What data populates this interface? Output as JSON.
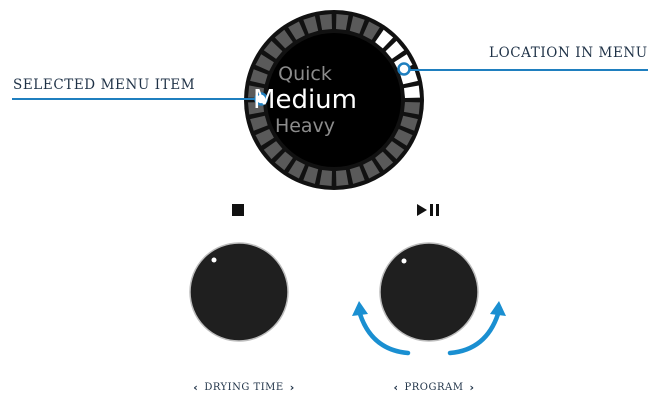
{
  "callouts": {
    "selected_menu_item": "SELECTED MENU ITEM",
    "location_in_menu": "LOCATION IN MENU"
  },
  "display": {
    "items": [
      "Quick",
      "Medium",
      "Heavy"
    ],
    "selected": "Medium"
  },
  "controls": {
    "stop_icon": "stop-icon",
    "play_pause_icon": "play-pause-icon",
    "left_knob_label": "DRYING TIME",
    "right_knob_label": "PROGRAM"
  },
  "colors": {
    "accent": "#1a8fd1",
    "knob": "#1f1f1f",
    "display_bezel": "#111111",
    "callout_line": "#1f7fbf",
    "label_text": "#1f3247"
  }
}
